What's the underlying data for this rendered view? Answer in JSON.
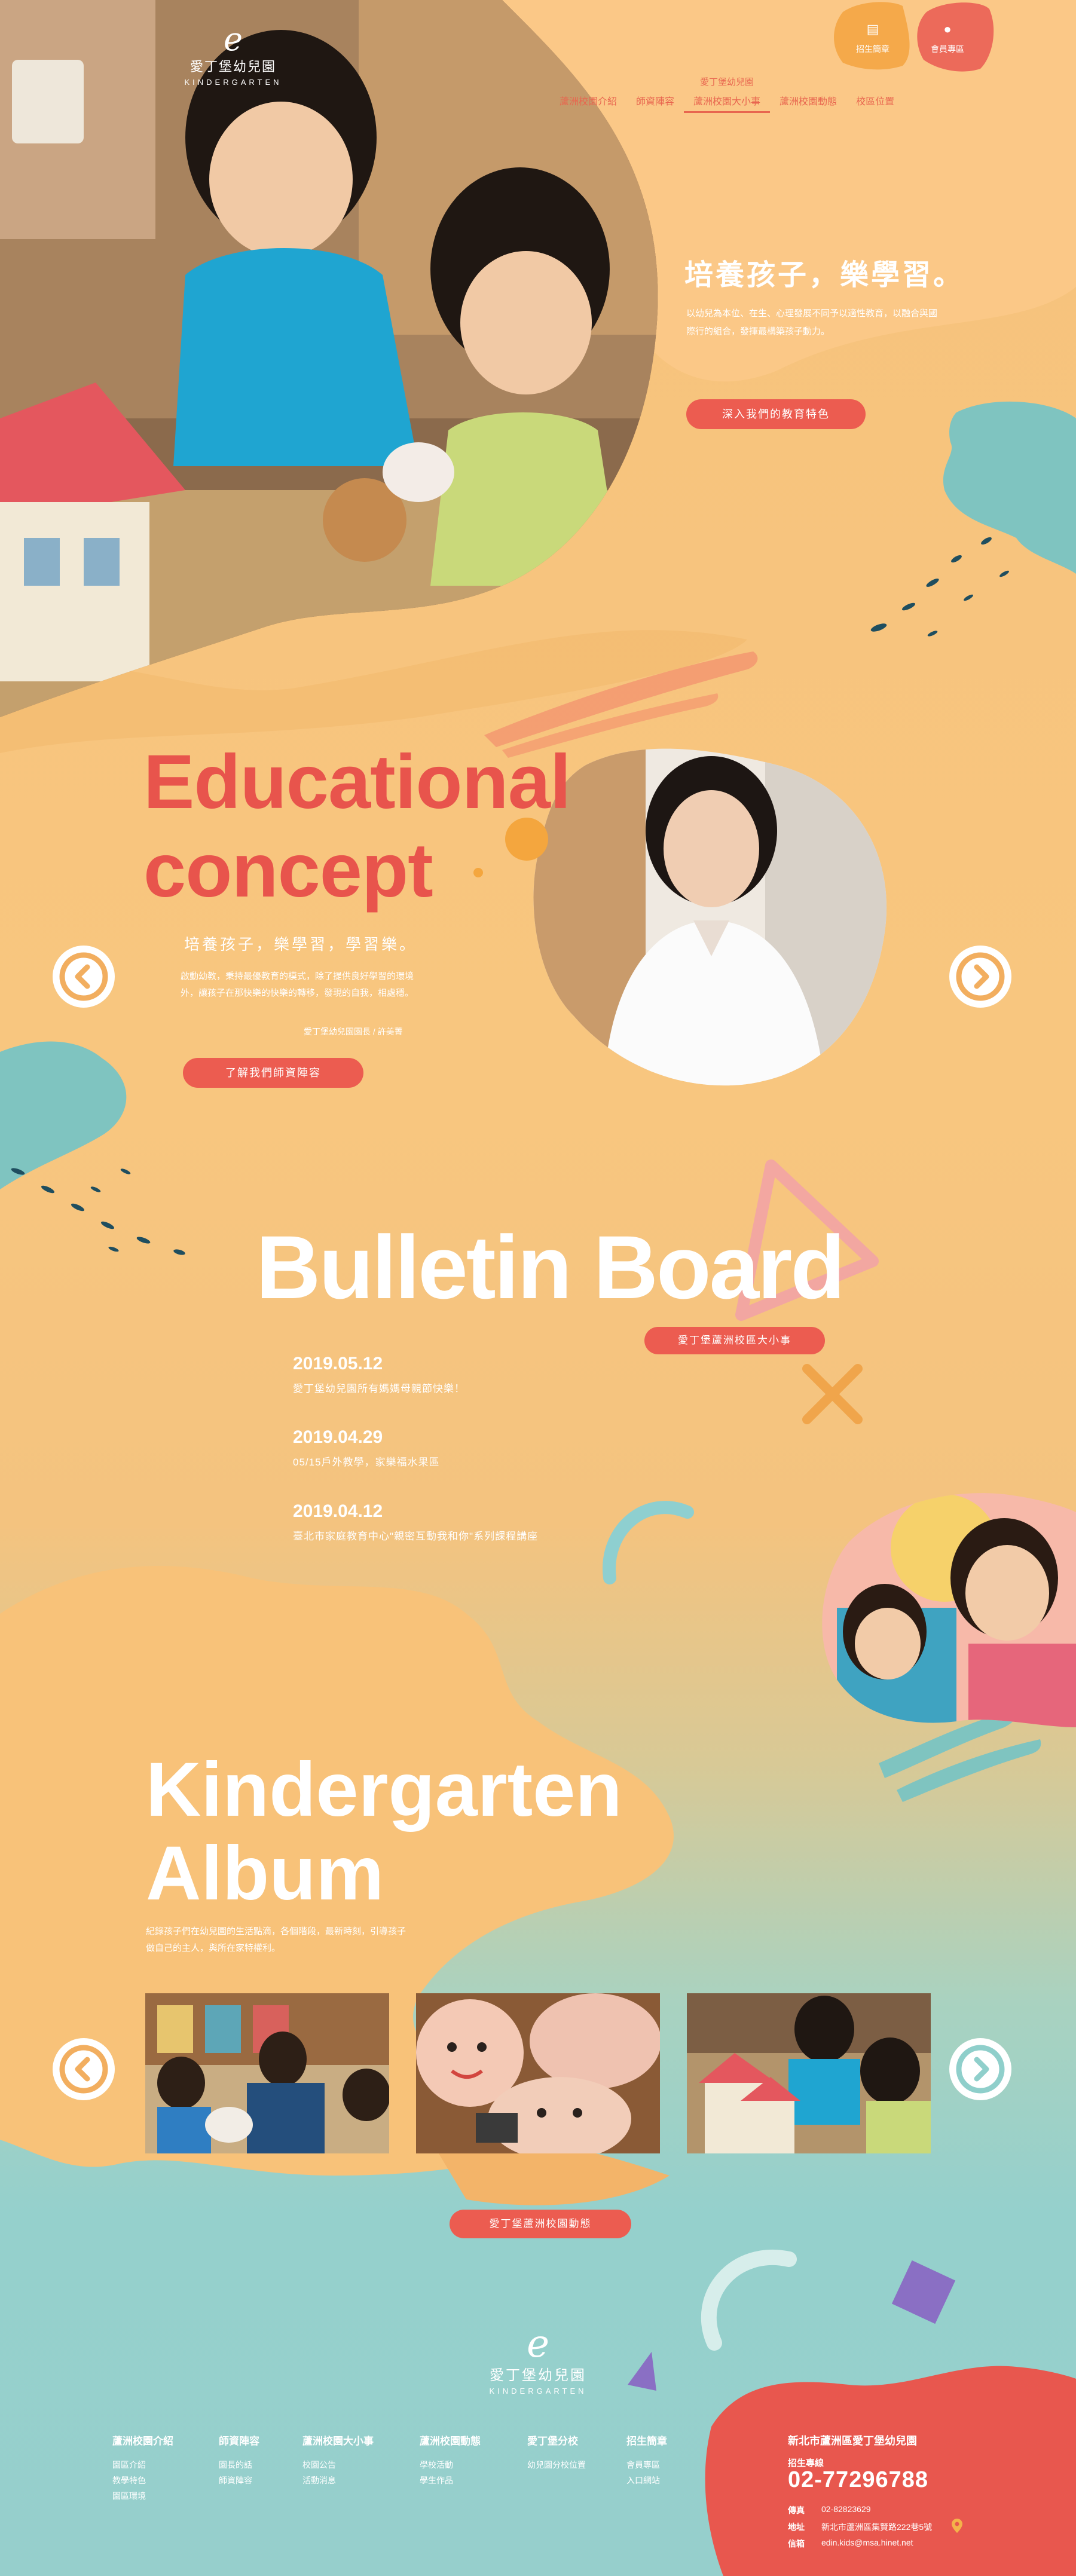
{
  "logo": {
    "mark": "e",
    "name": "愛丁堡幼兒園",
    "en": "KINDERGARTEN"
  },
  "quick_links": [
    {
      "icon": "document-icon",
      "label": "招生簡章"
    },
    {
      "icon": "member-icon",
      "label": "會員專區"
    }
  ],
  "nav": {
    "items": [
      "蘆洲校園介紹",
      "師資陣容",
      "蘆洲校園大小事",
      "蘆洲校園動態",
      "校區位置"
    ],
    "active_index": 2,
    "active_top_label": "愛丁堡幼兒園"
  },
  "hero": {
    "title": "培養孩子，樂學習。",
    "text": "以幼兒為本位、在生、心理發展不同予以適性教育，以融合與國際行的組合，發揮最構築孩子動力。",
    "button": "深入我們的教育特色"
  },
  "edu": {
    "title_line1": "Educational",
    "title_line2": "concept",
    "subtitle": "培養孩子，樂學習，學習樂。",
    "text": "啟動幼教，秉持最優教育的模式，除了提供良好學習的環境外，讓孩子在那快樂的快樂的轉移，發現的自我，相處穩。",
    "sign": "愛丁堡幼兒園園長 / 許美菁",
    "button": "了解我們師資陣容"
  },
  "bulletin": {
    "title": "Bulletin Board",
    "tag": "愛丁堡蘆洲校區大小事",
    "items": [
      {
        "date": "2019.05.12",
        "text": "愛丁堡幼兒園所有媽媽母親節快樂！"
      },
      {
        "date": "2019.04.29",
        "text": "05/15戶外教學，家樂福水果區"
      },
      {
        "date": "2019.04.12",
        "text": "臺北市家庭教育中心\"親密互動我和你\"系列課程講座"
      }
    ]
  },
  "album": {
    "title_line1": "Kindergarten",
    "title_line2": "Album",
    "text": "紀錄孩子們在幼兒園的生活點滴，各個階段，最新時刻，引導孩子做自己的主人，與所在家特權利。",
    "button": "愛丁堡蘆洲校園動態"
  },
  "footer": {
    "columns": [
      {
        "heading": "蘆洲校園介紹",
        "items": [
          "園區介紹",
          "教學特色",
          "園區環境"
        ]
      },
      {
        "heading": "師資陣容",
        "items": [
          "園長的話",
          "師資陣容"
        ]
      },
      {
        "heading": "蘆洲校園大小事",
        "items": [
          "校園公告",
          "活動消息"
        ]
      },
      {
        "heading": "蘆洲校園動態",
        "items": [
          "學校活動",
          "學生作品"
        ]
      },
      {
        "heading": "愛丁堡分校",
        "items": [
          "幼兒園分校位置"
        ]
      },
      {
        "heading": "招生簡章",
        "items": [
          "會員專區",
          "入口網站"
        ]
      }
    ],
    "contact": {
      "school": "新北市蘆洲區愛丁堡幼兒園",
      "hotline_label": "招生專線",
      "hotline": "02-77296788",
      "fax_label": "傳真",
      "fax": "02-8282362​9",
      "address_label": "地址",
      "address": "新北市蘆洲區集賢路222巷5號",
      "email_label": "信箱",
      "email": "edin.kids@msa.hinet.net"
    }
  },
  "colors": {
    "accent": "#ec5c50",
    "peach": "#f6c27c",
    "teal": "#96cfcc"
  }
}
